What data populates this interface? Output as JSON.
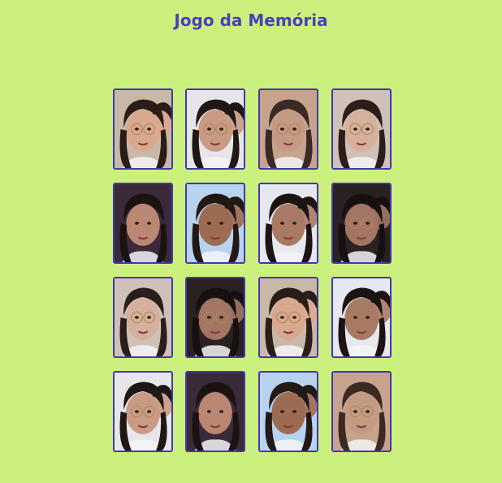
{
  "title": "Jogo da Memória",
  "cards": [
    {
      "photo": "kiss-on-cheek",
      "bg": "#c8b8a8",
      "skin": "#d8a98e",
      "hair": "#2a1c16",
      "glasses": true,
      "second": true
    },
    {
      "photo": "two-friends-pout",
      "bg": "#e6e6ea",
      "skin": "#c99a84",
      "hair": "#1f1714",
      "glasses": true,
      "second": true
    },
    {
      "photo": "closeup-glasses",
      "bg": "#c7a38e",
      "skin": "#c49a84",
      "hair": "#3b2a24",
      "glasses": true,
      "second": false
    },
    {
      "photo": "closeup-from-above",
      "bg": "#cfc0b8",
      "skin": "#d5b09c",
      "hair": "#2b1e1a",
      "glasses": true,
      "second": false
    },
    {
      "photo": "curly-selfie",
      "bg": "#3a2a3a",
      "skin": "#b98772",
      "hair": "#1b1212",
      "glasses": false,
      "second": false
    },
    {
      "photo": "hug-outdoors",
      "bg": "#b7d3ef",
      "skin": "#9b6b52",
      "hair": "#221814",
      "glasses": false,
      "second": true
    },
    {
      "photo": "stadium-selfie",
      "bg": "#e5e8ee",
      "skin": "#a97a63",
      "hair": "#1c1412",
      "glasses": false,
      "second": true
    },
    {
      "photo": "dark-selfie",
      "bg": "#2a2222",
      "skin": "#a27564",
      "hair": "#171010",
      "glasses": true,
      "second": true
    },
    {
      "photo": "closeup-from-above",
      "bg": "#cfc0b8",
      "skin": "#d5b09c",
      "hair": "#2b1e1a",
      "glasses": true,
      "second": false
    },
    {
      "photo": "dark-selfie",
      "bg": "#2a2222",
      "skin": "#a27564",
      "hair": "#171010",
      "glasses": true,
      "second": true
    },
    {
      "photo": "kiss-on-cheek",
      "bg": "#c8b8a8",
      "skin": "#d8a98e",
      "hair": "#2a1c16",
      "glasses": true,
      "second": true
    },
    {
      "photo": "stadium-selfie",
      "bg": "#e5e8ee",
      "skin": "#a97a63",
      "hair": "#1c1412",
      "glasses": false,
      "second": true
    },
    {
      "photo": "two-friends-pout",
      "bg": "#e6e6ea",
      "skin": "#c99a84",
      "hair": "#1f1714",
      "glasses": true,
      "second": true
    },
    {
      "photo": "curly-selfie",
      "bg": "#3a2a3a",
      "skin": "#b98772",
      "hair": "#1b1212",
      "glasses": false,
      "second": false
    },
    {
      "photo": "hug-outdoors",
      "bg": "#b7d3ef",
      "skin": "#9b6b52",
      "hair": "#221814",
      "glasses": false,
      "second": true
    },
    {
      "photo": "closeup-glasses",
      "bg": "#c7a38e",
      "skin": "#c49a84",
      "hair": "#3b2a24",
      "glasses": true,
      "second": false
    }
  ],
  "colors": {
    "background": "#ccf07d",
    "title": "#4a3fbf",
    "card_border": "#4436b3"
  }
}
